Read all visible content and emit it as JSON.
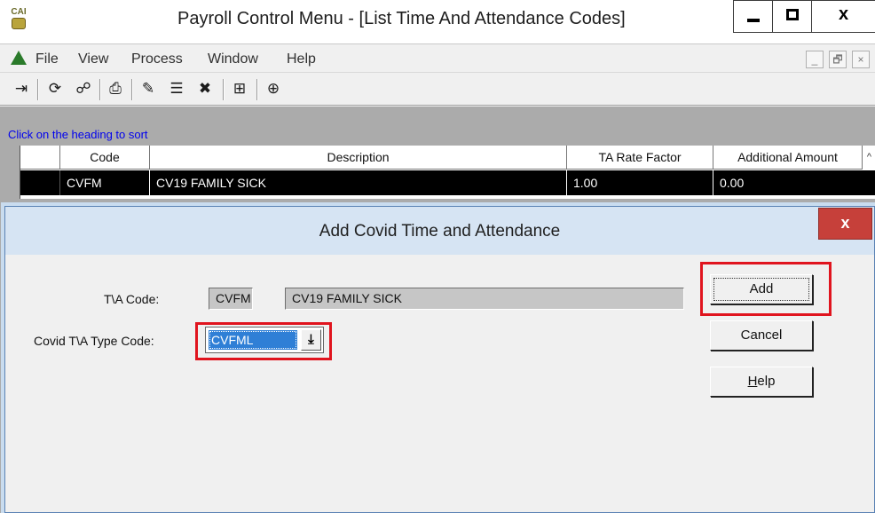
{
  "window": {
    "logo_text": "CAI",
    "title": "Payroll Control Menu - [List Time And Attendance Codes]",
    "min_glyph": "",
    "close_glyph": "x"
  },
  "menu": {
    "items": [
      "File",
      "View",
      "Process",
      "Window",
      "Help"
    ],
    "mdi_min": "_",
    "mdi_restore": "🗗",
    "mdi_close": "×"
  },
  "toolbar": {
    "icons": [
      "exit-icon",
      "refresh-icon",
      "binoculars-icon",
      "print-icon",
      "add-icon",
      "edit-icon",
      "delete-icon",
      "tree-icon",
      "help-icon"
    ]
  },
  "grid": {
    "sort_hint": "Click on the heading to sort",
    "columns": [
      "Code",
      "Description",
      "TA Rate Factor",
      "Additional Amount"
    ],
    "rows": [
      {
        "code": "CVFM",
        "description": "CV19 FAMILY SICK",
        "rate_factor": "1.00",
        "additional_amount": "0.00"
      }
    ]
  },
  "dialog": {
    "title": "Add Covid Time and Attendance",
    "close_glyph": "x",
    "ta_code_label": "T\\A Code:",
    "ta_code_value": "CVFM",
    "ta_desc_value": "CV19 FAMILY SICK",
    "covid_type_label": "Covid T\\A Type Code:",
    "covid_type_value": "CVFML",
    "add_label": "Add",
    "cancel_label": "Cancel",
    "help_label_accel": "H",
    "help_label_rest": "elp",
    "highlight_color": "#e0141e"
  }
}
